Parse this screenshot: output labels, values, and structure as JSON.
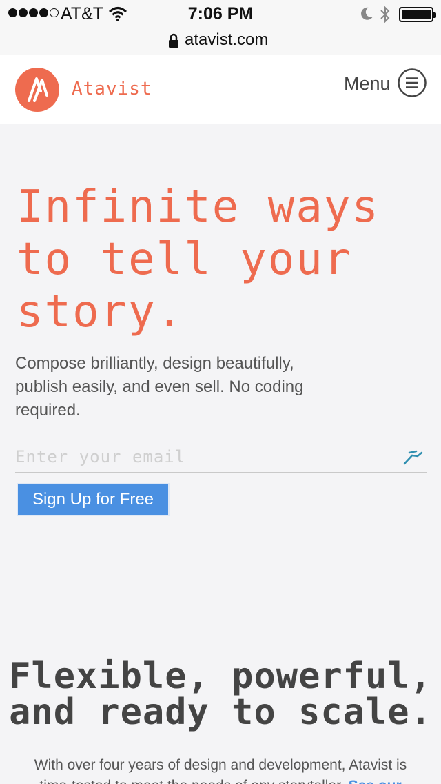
{
  "status_bar": {
    "carrier": "AT&T",
    "time": "7:06 PM",
    "signal_bars": 4,
    "signal_total": 5
  },
  "browser": {
    "url": "atavist.com"
  },
  "header": {
    "brand": "Atavist",
    "menu_label": "Menu"
  },
  "hero": {
    "title_lines": [
      "Infinite ways",
      "to tell your",
      "story."
    ],
    "subtitle_lines": [
      "Compose brilliantly, design beautifully,",
      "publish easily, and even sell. No coding",
      "required."
    ],
    "email_placeholder": "Enter your email",
    "signup_label": "Sign Up for Free"
  },
  "section2": {
    "title_lines": [
      "Flexible, powerful,",
      "and ready to scale."
    ],
    "body_line1": "With over four years of design and development, Atavist is",
    "body_line2": "time-tested to meet the needs of any storyteller.",
    "body_link": "See our"
  },
  "colors": {
    "accent": "#ee6b4f",
    "button": "#4a90e2",
    "background": "#f4f4f6"
  }
}
